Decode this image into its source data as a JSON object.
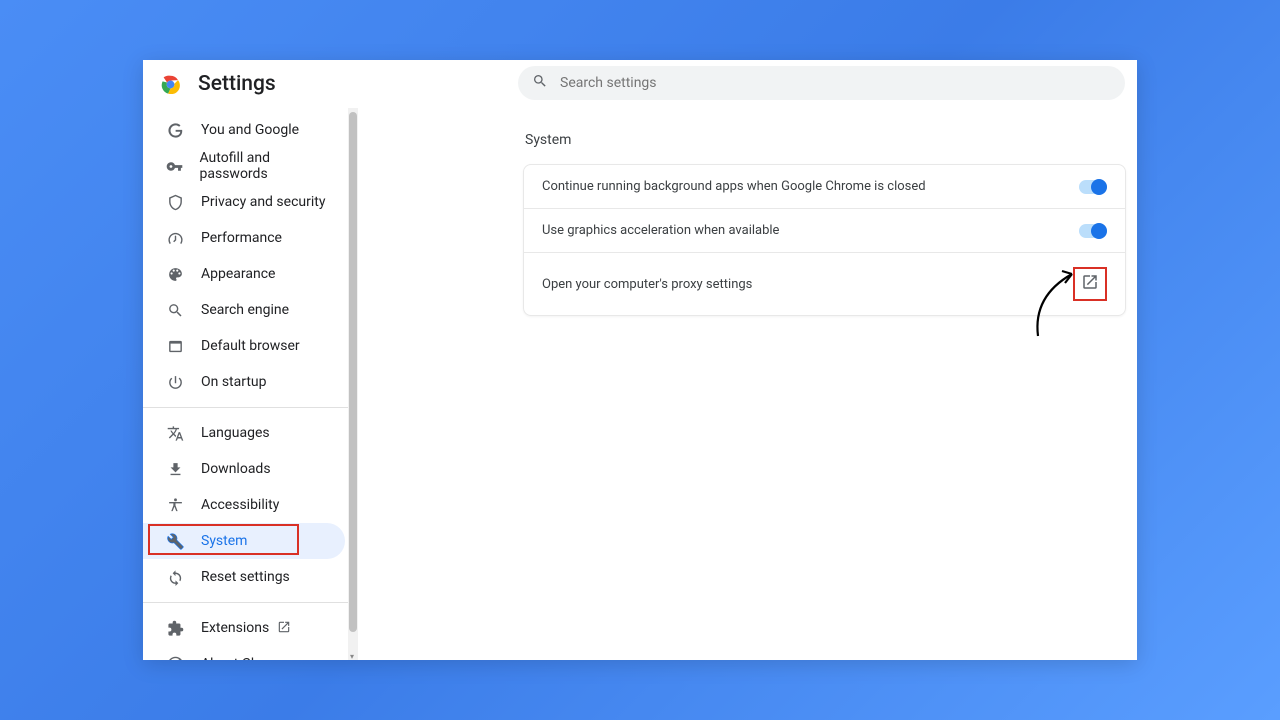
{
  "header": {
    "title": "Settings"
  },
  "search": {
    "placeholder": "Search settings"
  },
  "sidebar": {
    "groups": [
      [
        {
          "id": "you-and-google",
          "label": "You and Google",
          "icon": "google"
        },
        {
          "id": "autofill",
          "label": "Autofill and passwords",
          "icon": "key"
        },
        {
          "id": "privacy",
          "label": "Privacy and security",
          "icon": "shield"
        },
        {
          "id": "performance",
          "label": "Performance",
          "icon": "speedometer"
        },
        {
          "id": "appearance",
          "label": "Appearance",
          "icon": "palette"
        },
        {
          "id": "search-engine",
          "label": "Search engine",
          "icon": "search"
        },
        {
          "id": "default-browser",
          "label": "Default browser",
          "icon": "browser"
        },
        {
          "id": "on-startup",
          "label": "On startup",
          "icon": "power"
        }
      ],
      [
        {
          "id": "languages",
          "label": "Languages",
          "icon": "translate"
        },
        {
          "id": "downloads",
          "label": "Downloads",
          "icon": "download"
        },
        {
          "id": "accessibility",
          "label": "Accessibility",
          "icon": "accessibility"
        },
        {
          "id": "system",
          "label": "System",
          "icon": "wrench",
          "active": true
        },
        {
          "id": "reset",
          "label": "Reset settings",
          "icon": "reset"
        }
      ],
      [
        {
          "id": "extensions",
          "label": "Extensions",
          "icon": "extension",
          "ext": true
        },
        {
          "id": "about",
          "label": "About Chrome",
          "icon": "chrome"
        }
      ]
    ]
  },
  "main": {
    "section_title": "System",
    "rows": [
      {
        "label": "Continue running background apps when Google Chrome is closed",
        "type": "toggle",
        "toggled": true
      },
      {
        "label": "Use graphics acceleration when available",
        "type": "toggle",
        "toggled": true
      },
      {
        "label": "Open your computer's proxy settings",
        "type": "open",
        "highlighted": true
      }
    ]
  }
}
